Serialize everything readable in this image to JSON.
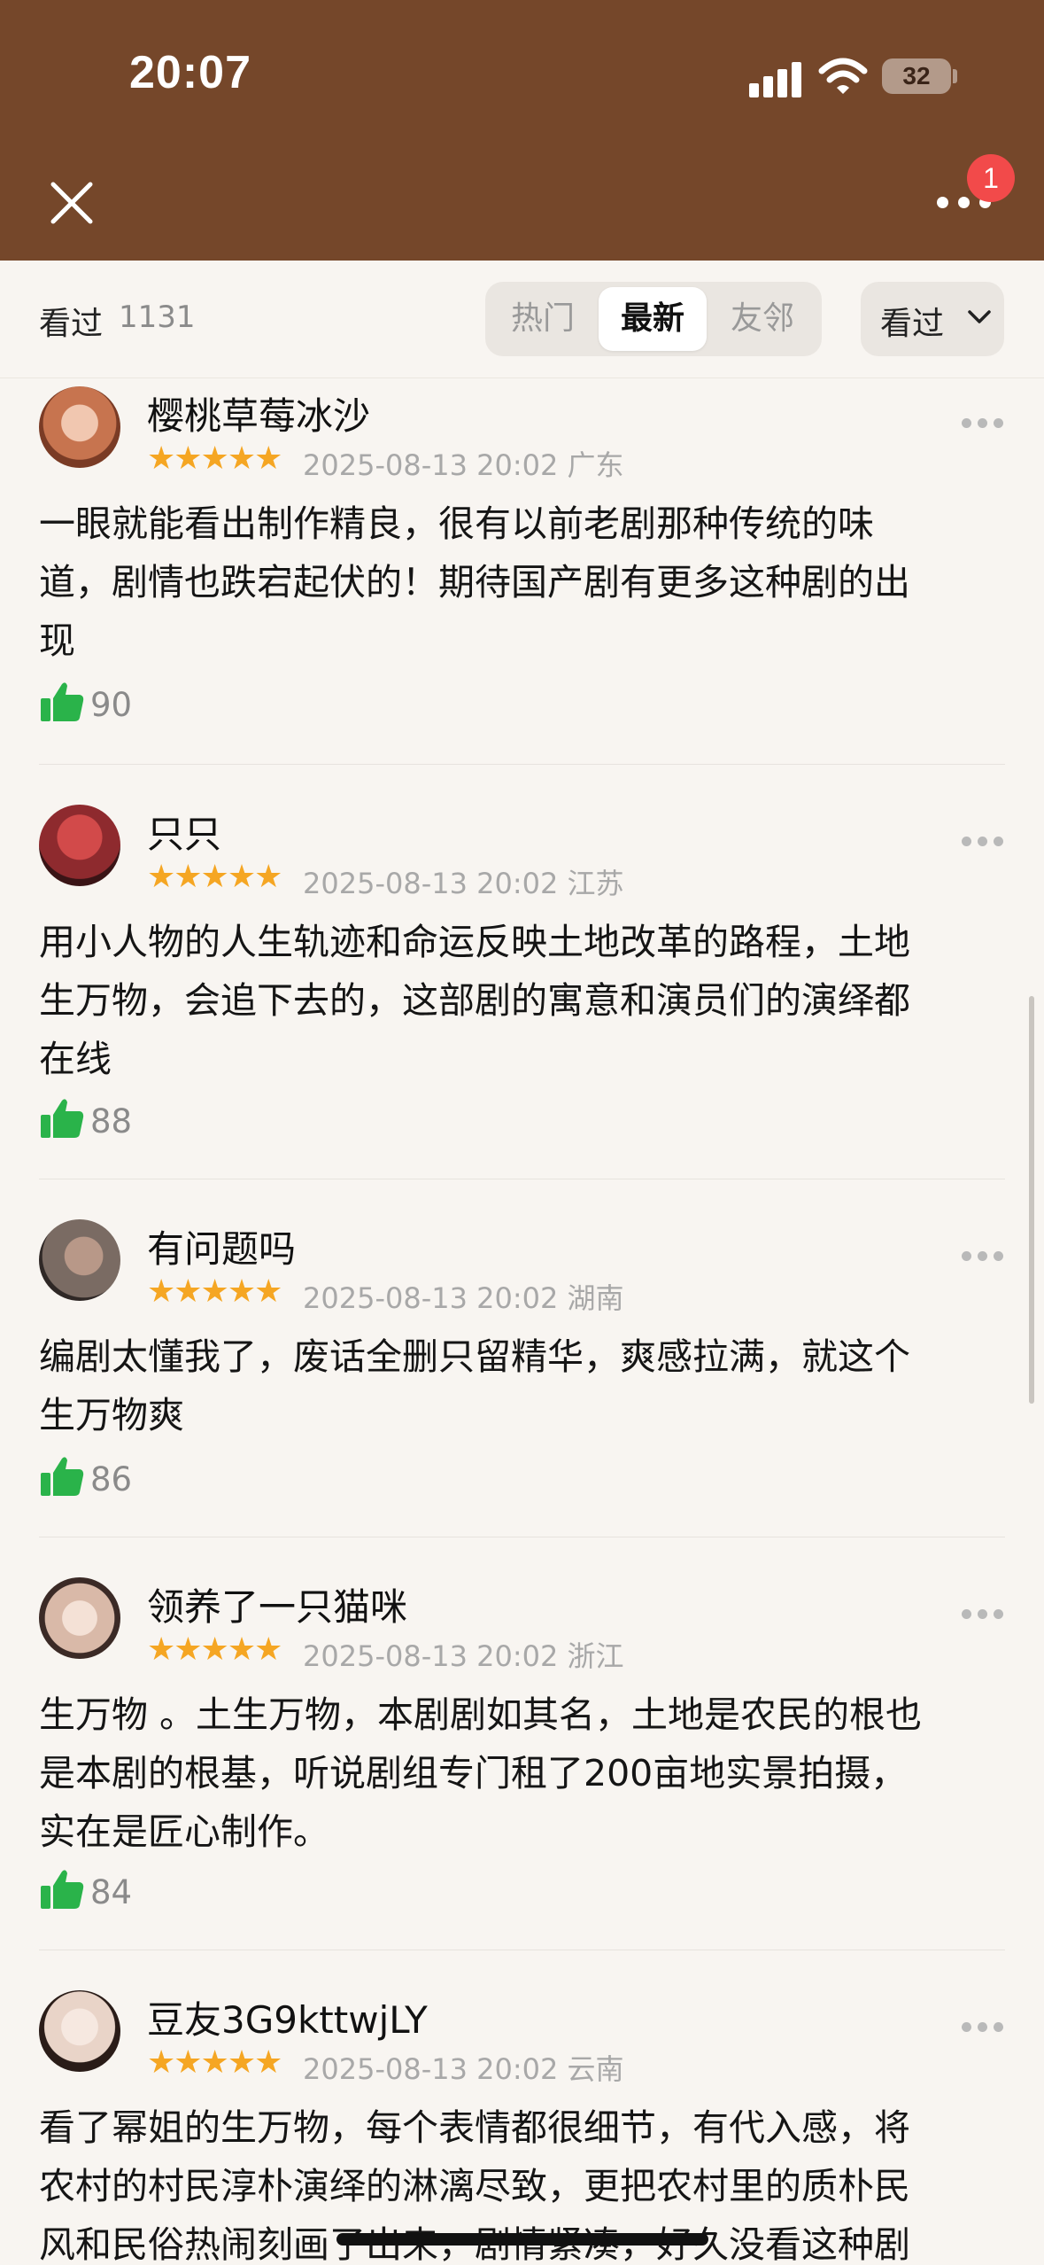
{
  "status_bar": {
    "time": "20:07",
    "battery": "32"
  },
  "header": {
    "notification_count": "1"
  },
  "filter": {
    "seen_label": "看过",
    "seen_count": "1131",
    "tabs": [
      "热门",
      "最新",
      "友邻"
    ],
    "active_tab": "最新",
    "dropdown_label": "看过"
  },
  "reviews": [
    {
      "user": "樱桃草莓冰沙",
      "stars": "★★★★★",
      "date": "2025-08-13 20:02",
      "location": "广东",
      "lines": [
        "一眼就能看出制作精良，很有以前老剧那种传统的味",
        "道，剧情也跌宕起伏的！期待国产剧有更多这种剧的出",
        "现"
      ],
      "likes": "90",
      "avatar_color": "#c7744f"
    },
    {
      "user": "只只",
      "stars": "★★★★★",
      "date": "2025-08-13 20:02",
      "location": "江苏",
      "lines": [
        "用小人物的人生轨迹和命运反映土地改革的路程，土地",
        "生万物，会追下去的，这部剧的寓意和演员们的演绎都",
        "在线"
      ],
      "likes": "88",
      "avatar_color": "#8e2a2e"
    },
    {
      "user": "有问题吗",
      "stars": "★★★★★",
      "date": "2025-08-13 20:02",
      "location": "湖南",
      "lines": [
        "编剧太懂我了，废话全删只留精华，爽感拉满，就这个",
        "生万物爽"
      ],
      "likes": "86",
      "avatar_color": "#7a6b63"
    },
    {
      "user": "领养了一只猫咪",
      "stars": "★★★★★",
      "date": "2025-08-13 20:02",
      "location": "浙江",
      "lines": [
        "生万物 。土生万物，本剧剧如其名，土地是农民的根也",
        "是本剧的根基，听说剧组专门租了200亩地实景拍摄，",
        "实在是匠心制作。"
      ],
      "likes": "84",
      "avatar_color": "#d9b9a8"
    },
    {
      "user": "豆友3G9kttwjLY",
      "stars": "★★★★★",
      "date": "2025-08-13 20:02",
      "location": "云南",
      "lines": [
        "看了幂姐的生万物，每个表情都很细节，有代入感，将",
        "农村的村民淳朴演绎的淋漓尽致，更把农村里的质朴民",
        "风和民俗热闹刻画了出来，剧情紧凑，好久没看这种剧"
      ],
      "likes": "",
      "avatar_color": "#e9d4c8"
    }
  ]
}
